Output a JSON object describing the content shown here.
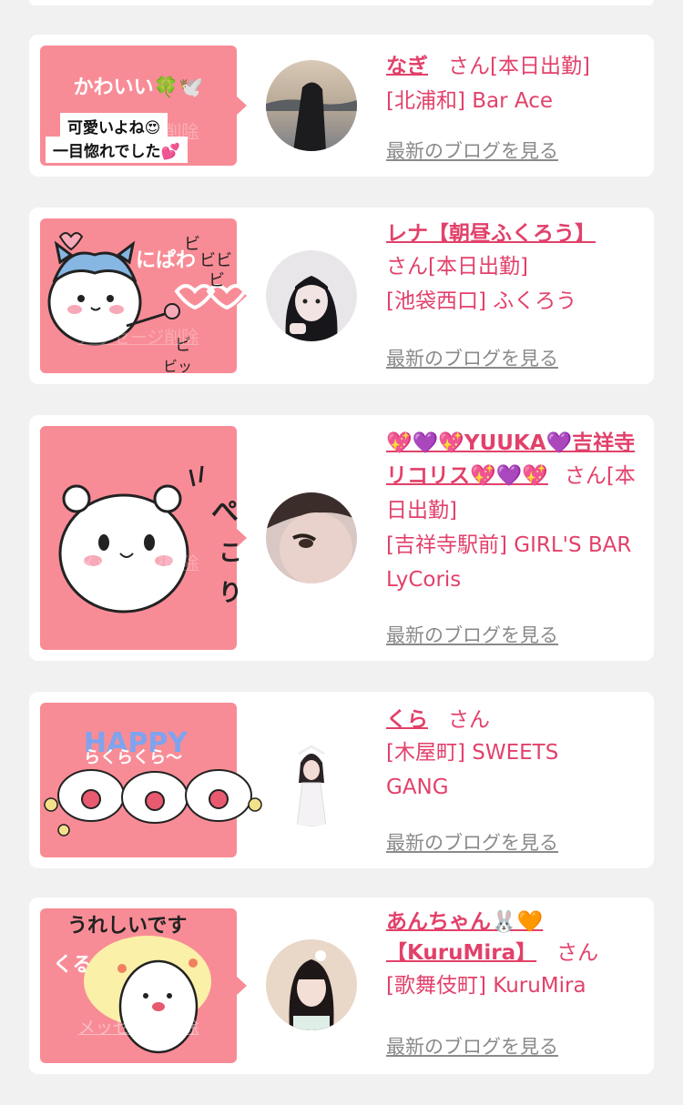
{
  "colors": {
    "accent": "#e2416a",
    "bubble": "#f88c96",
    "link_gray": "#8a8a8a"
  },
  "common": {
    "blog_link": "最新のブログを見る",
    "san": "さん",
    "on_duty": "[本日出勤]",
    "message_link": "メッセージ削除"
  },
  "cards": [
    {
      "bubble_text": "かわいい🍀🕊️",
      "sticker_lines": [
        "可愛いよね😍",
        "一目惚れでした💕"
      ],
      "name": "なぎ",
      "san": "さん",
      "duty": "[本日出勤]",
      "shop": "[北浦和] Bar Ace"
    },
    {
      "bubble_text": "にぱわ",
      "sticker_words": [
        "ビ",
        "ビビ",
        "ビ",
        "ビ",
        "ビッ"
      ],
      "name": "レナ【朝昼ふくろう】",
      "san": "さん",
      "duty": "[本日出勤]",
      "shop": "[池袋西口] ふくろう"
    },
    {
      "bubble_text": "",
      "sticker_words": [
        "ぺ",
        "こ",
        "り"
      ],
      "name": "💖💜💖YUUKA💜吉祥寺リコリス💖💜💖",
      "san": "さ",
      "duty": "ん[本日出勤]",
      "shop": "[吉祥寺駅前] GIRL'S BAR LyCoris"
    },
    {
      "bubble_text": "",
      "sticker_words": [
        "HAPPY",
        "らくらくら〜"
      ],
      "name": "くら",
      "san": "さん",
      "duty": "",
      "shop": "[木屋町] SWEETS GANG"
    },
    {
      "bubble_text": "くる",
      "sticker_words": [
        "うれしいです"
      ],
      "name": "あんちゃん🐰🧡",
      "name2": "【KuruMira】",
      "san": "さん",
      "duty": "",
      "shop": "[歌舞伎町] KuruMira"
    }
  ]
}
